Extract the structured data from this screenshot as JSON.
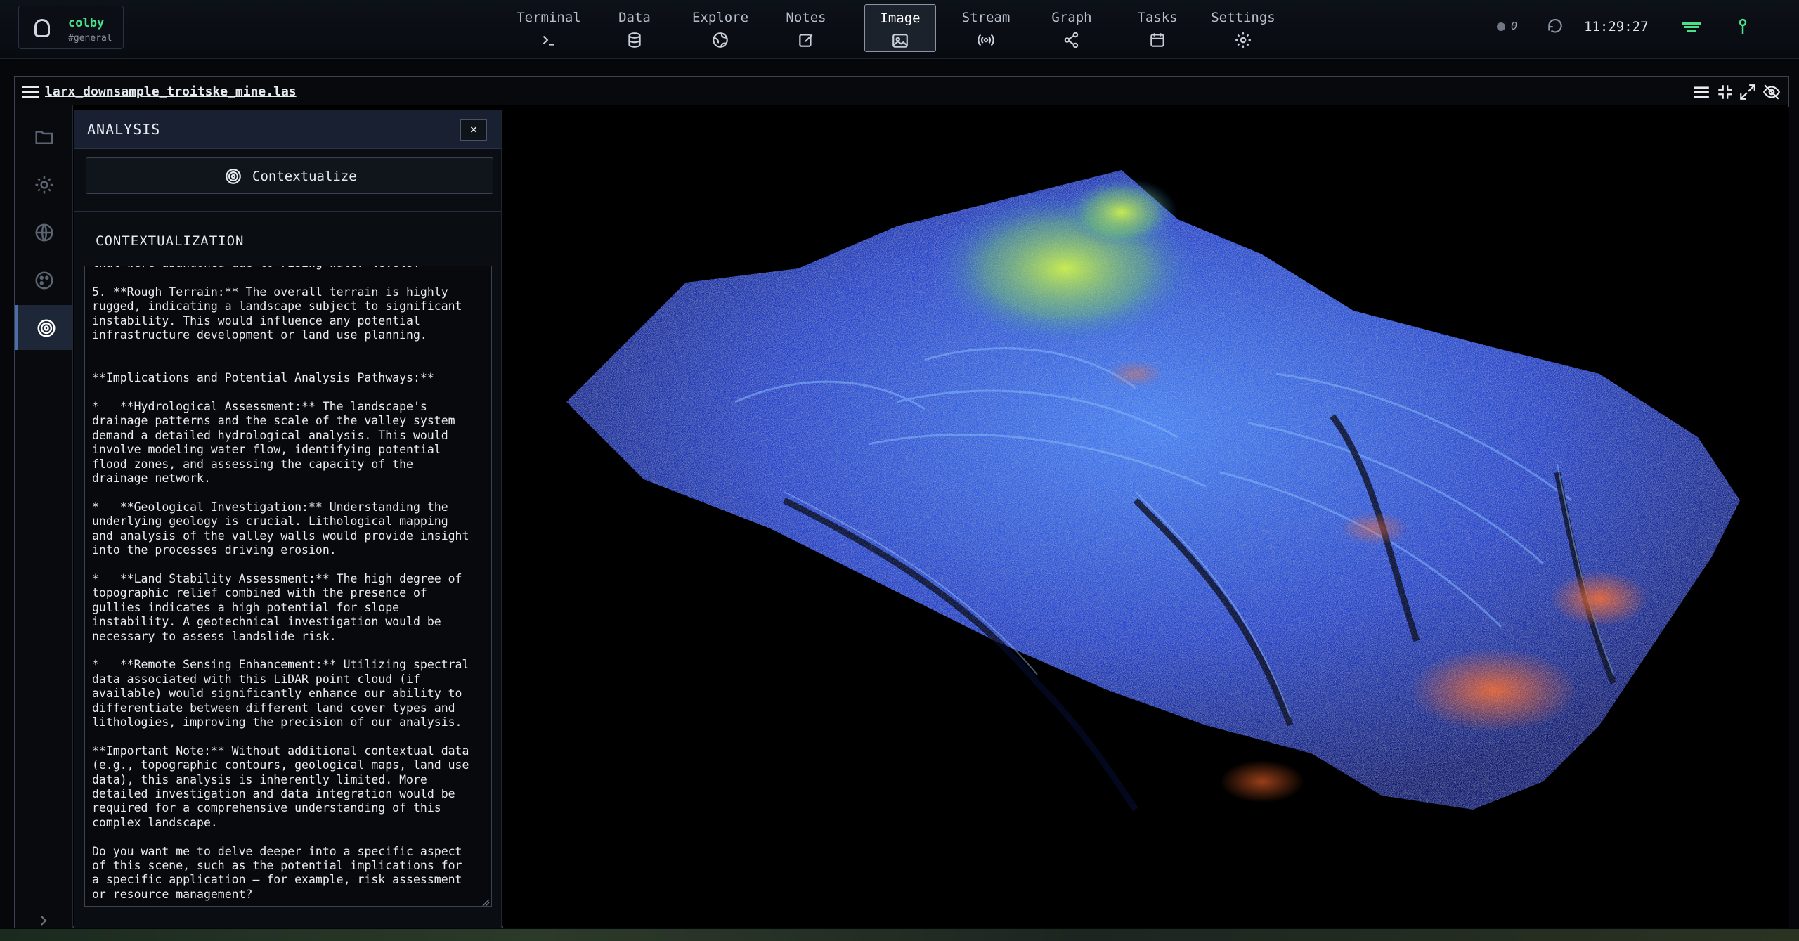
{
  "brand": {
    "name": "colby",
    "channel": "#general"
  },
  "nav": [
    {
      "label": "Terminal",
      "icon": "terminal-icon"
    },
    {
      "label": "Data",
      "icon": "database-icon"
    },
    {
      "label": "Explore",
      "icon": "globe-icon"
    },
    {
      "label": "Notes",
      "icon": "edit-icon"
    },
    {
      "label": "Image",
      "icon": "image-icon",
      "active": true
    },
    {
      "label": "Stream",
      "icon": "broadcast-icon"
    },
    {
      "label": "Graph",
      "icon": "share-icon"
    },
    {
      "label": "Tasks",
      "icon": "calendar-icon"
    },
    {
      "label": "Settings",
      "icon": "gear-icon"
    }
  ],
  "status": {
    "count": "0",
    "time": "11:29:27"
  },
  "window": {
    "filename": "larx_downsample_troitske_mine.las"
  },
  "panel": {
    "title": "ANALYSIS",
    "close": "×",
    "contextualize_label": "Contextualize",
    "section_title": "CONTEXTUALIZATION",
    "text": "that were abandoned due to rising water levels.\n\n5. **Rough Terrain:** The overall terrain is highly\nrugged, indicating a landscape subject to significant\ninstability. This would influence any potential\ninfrastructure development or land use planning.\n\n\n**Implications and Potential Analysis Pathways:**\n\n*   **Hydrological Assessment:** The landscape's\ndrainage patterns and the scale of the valley system\ndemand a detailed hydrological analysis. This would\ninvolve modeling water flow, identifying potential\nflood zones, and assessing the capacity of the\ndrainage network.\n\n*   **Geological Investigation:** Understanding the\nunderlying geology is crucial. Lithological mapping\nand analysis of the valley walls would provide insight\ninto the processes driving erosion.\n\n*   **Land Stability Assessment:** The high degree of\ntopographic relief combined with the presence of\ngullies indicates a high potential for slope\ninstability. A geotechnical investigation would be\nnecessary to assess landslide risk.\n\n*   **Remote Sensing Enhancement:** Utilizing spectral\ndata associated with this LiDAR point cloud (if\navailable) would significantly enhance our ability to\ndifferentiate between different land cover types and\nlithologies, improving the precision of our analysis.\n\n**Important Note:** Without additional contextual data\n(e.g., topographic contours, geological maps, land use\ndata), this analysis is inherently limited. More\ndetailed investigation and data integration would be\nrequired for a comprehensive understanding of this\ncomplex landscape.\n\nDo you want me to delve deeper into a specific aspect\nof this scene, such as the potential implications for\na specific application – for example, risk assessment\nor resource management?"
  },
  "rail": [
    {
      "icon": "folder-icon"
    },
    {
      "icon": "gear-icon"
    },
    {
      "icon": "globe-icon"
    },
    {
      "icon": "palette-icon"
    },
    {
      "icon": "target-icon",
      "active": true
    }
  ],
  "colors": {
    "accent_green": "#4be08a",
    "panel_header": "#182032",
    "active_rail": "#1d2738"
  }
}
